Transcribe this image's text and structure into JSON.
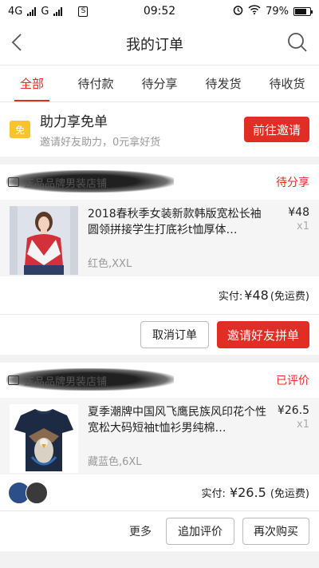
{
  "status_bar": {
    "carrier1": "4G",
    "carrier2": "G",
    "time": "09:52",
    "battery": "79%",
    "battery_level": 0.79
  },
  "nav": {
    "title": "我的订单"
  },
  "tabs": [
    {
      "label": "全部",
      "active": true
    },
    {
      "label": "待付款"
    },
    {
      "label": "待分享"
    },
    {
      "label": "待发货"
    },
    {
      "label": "待收货"
    }
  ],
  "promo": {
    "icon_text": "免",
    "title": "助力享免单",
    "subtitle": "邀请好友助力，0元拿好货",
    "button": "前往邀请"
  },
  "orders": [
    {
      "store": "正品品牌男装店铺",
      "status": "待分享",
      "product_name": "2018春秋季女装新款韩版宽松长袖圆领拼接学生打底衫t恤厚体…",
      "spec": "红色,XXL",
      "price": "¥48",
      "qty": "x1",
      "paid_label": "实付:",
      "paid_amount": "¥48",
      "paid_note": "(免运费)",
      "actions": [
        "取消订单",
        "邀请好友拼单"
      ]
    },
    {
      "store": "正品品牌男装店铺",
      "status": "已评价",
      "product_name": "夏季潮牌中国风飞鹰民族风印花个性宽松大码短袖t恤衫男纯棉…",
      "spec": "藏蓝色,6XL",
      "price": "¥26.5",
      "qty": "x1",
      "paid_label": "实付:",
      "paid_amount": "¥26.5",
      "paid_note": "(免运费)",
      "more": "更多",
      "actions": [
        "追加评价",
        "再次购买"
      ]
    }
  ],
  "colors": {
    "accent": "#e02e24",
    "background": "#f2f2f2"
  }
}
